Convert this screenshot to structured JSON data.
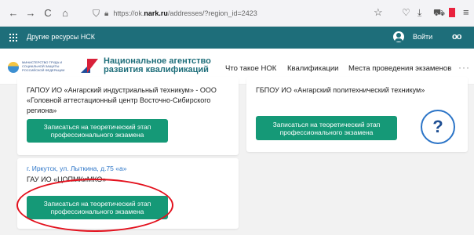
{
  "browser": {
    "url_prefix": "https://ok.",
    "url_domain": "nark.ru",
    "url_rest": "/addresses/?region_id=2423",
    "nav_icons": {
      "back": "←",
      "forward": "→",
      "reload": "C",
      "home": "⌂"
    },
    "toolbar_icons": [
      "star-icon",
      "pocket-icon",
      "download-icon",
      "cart-icon",
      "flag-icon",
      "menu-icon"
    ]
  },
  "strip": {
    "other_resources": "Другие ресурсы НСК",
    "login": "Войти"
  },
  "header": {
    "ministry_text": "МИНИСТЕРСТВО ТРУДА И СОЦИАЛЬНОЙ ЗАЩИТЫ РОССИЙСКОЙ ФЕДЕРАЦИИ",
    "brand_line1": "Национальное агентство",
    "brand_line2": "развития квалификаций",
    "nav": [
      "Что такое НОК",
      "Квалификации",
      "Места проведения экзаменов"
    ],
    "more": "···"
  },
  "cards": [
    {
      "org": "ГАПОУ ИО «Ангарский индустриальный техникум» - ООО «Головной аттестационный центр Восточно-Сибирского региона»",
      "button": "Записаться на теоретический этап профессионального экзамена"
    },
    {
      "org": "ГБПОУ ИО «Ангарский политехнический техникум»",
      "button": "Записаться на теоретический этап профессионального экзамена",
      "help": "?"
    },
    {
      "address": "г. Иркутск, ул. Лыткина, д.75 «а»",
      "org": "ГАУ ИО «ЦОПМКиМКО»",
      "button": "Записаться на теоретический этап профессионального экзамена"
    }
  ],
  "colors": {
    "strip_bg": "#1e6e7a",
    "button_green": "#159977",
    "link_blue": "#2b74c7",
    "highlight_red": "#e3101c"
  }
}
